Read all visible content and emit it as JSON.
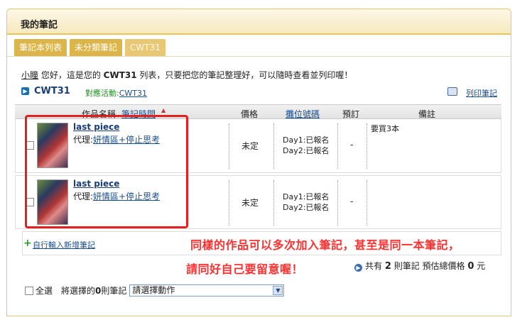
{
  "panel": {
    "title": "我的筆記"
  },
  "tabs": [
    {
      "label": "筆記本列表"
    },
    {
      "label": "未分類筆記"
    },
    {
      "label": "CWT31"
    }
  ],
  "intro": {
    "user": "小瞳",
    "prefix": " 您好，這是您的 ",
    "event": "CWT31",
    "suffix": " 列表，只要把您的筆記整理好，可以隨時查看並列印喔！"
  },
  "notebook": {
    "name": "CWT31",
    "event_label": "對應活動:",
    "event_link": "CWT31",
    "print_label": "列印筆記"
  },
  "table": {
    "headers": {
      "work_name": "作品名稱",
      "note_time": "筆記時間",
      "price": "價格",
      "booth": "攤位號碼",
      "order": "預訂",
      "remark": "備註"
    },
    "rows": [
      {
        "title": "last piece",
        "agent_label": "代理:",
        "agent": "妍情區+停止思考",
        "price": "未定",
        "day1": "Day1:已報名",
        "day2": "Day2:已報名",
        "order": "-",
        "remark": "要買3本"
      },
      {
        "title": "last piece",
        "agent_label": "代理:",
        "agent": "妍情區+停止思考",
        "price": "未定",
        "day1": "Day1:已報名",
        "day2": "Day2:已報名",
        "order": "-",
        "remark": ""
      }
    ]
  },
  "add": {
    "label": "自行輸入新增筆記"
  },
  "summary": {
    "prefix": "共有 ",
    "count": "2",
    "middle": " 則筆記 預估總價格 ",
    "total": "0",
    "suffix": " 元"
  },
  "bulk": {
    "select_all": "全選",
    "prefix": "將選擇的 ",
    "count": "0",
    "suffix": " 則筆記",
    "action_select": "請選擇動作"
  },
  "annotation": {
    "line1": "同樣的作品可以多次加入筆記，甚至是同一本筆記，",
    "line2": "請同好自己要留意喔！",
    "color": "#ff3030"
  }
}
